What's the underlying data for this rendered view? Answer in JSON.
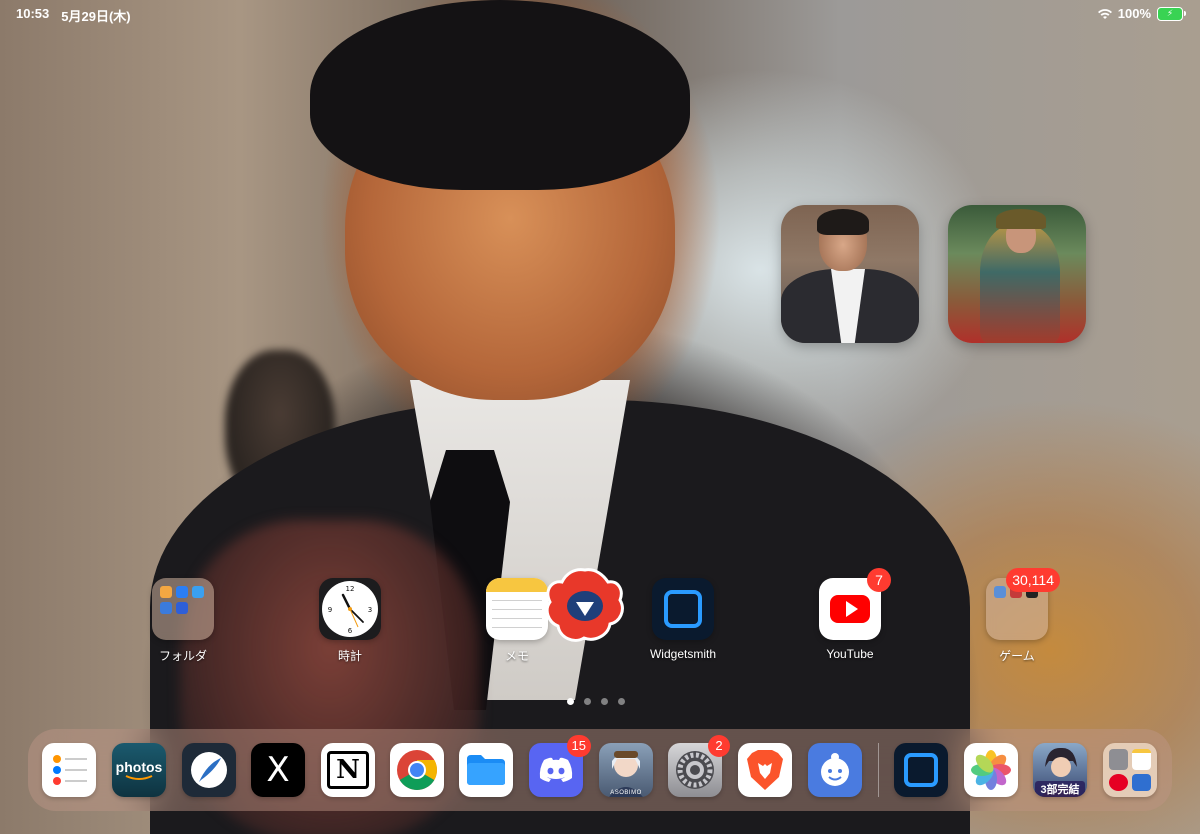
{
  "status": {
    "time": "10:53",
    "date": "5月29日(木)",
    "battery": "100%"
  },
  "home_apps": [
    {
      "label": "フォルダ",
      "icon": "folder-icon"
    },
    {
      "label": "時計",
      "icon": "clock-icon"
    },
    {
      "label": "メモ",
      "icon": "notes-icon"
    },
    {
      "label": "Widgetsmith",
      "icon": "widgetsmith-icon"
    },
    {
      "label": "YouTube",
      "icon": "youtube-icon",
      "badge": "7"
    },
    {
      "label": "ゲーム",
      "icon": "folder-icon",
      "badge": "30,114"
    }
  ],
  "dock": {
    "items": [
      {
        "name": "reminders",
        "icon": "reminders-icon"
      },
      {
        "name": "amazon-photos",
        "icon": "amazon-photos-icon",
        "label": "photos"
      },
      {
        "name": "quill-app",
        "icon": "quill-pen-icon"
      },
      {
        "name": "x",
        "icon": "x-logo-icon",
        "label": "X"
      },
      {
        "name": "notion",
        "icon": "notion-icon",
        "label": "N"
      },
      {
        "name": "chrome",
        "icon": "chrome-icon"
      },
      {
        "name": "files",
        "icon": "files-folder-icon"
      },
      {
        "name": "discord",
        "icon": "discord-icon",
        "badge": "15"
      },
      {
        "name": "asobimo-game",
        "icon": "anime-character-icon",
        "label": "ASOBIMO"
      },
      {
        "name": "settings",
        "icon": "gear-icon",
        "badge": "2"
      },
      {
        "name": "brave",
        "icon": "brave-lion-icon"
      },
      {
        "name": "baby-face-app",
        "icon": "baby-face-icon"
      },
      {
        "name": "widgetsmith",
        "icon": "widgetsmith-icon"
      },
      {
        "name": "photos",
        "icon": "photos-flower-icon"
      },
      {
        "name": "game-app",
        "icon": "anime-character-icon",
        "label": "3部完結"
      },
      {
        "name": "app-library",
        "icon": "app-library-icon"
      }
    ]
  },
  "page_dots": {
    "count": 4,
    "active_index": 0
  },
  "colors": {
    "badge": "#ff3b30",
    "battery": "#39d353",
    "widgetsmith_blue": "#2a9bff"
  }
}
